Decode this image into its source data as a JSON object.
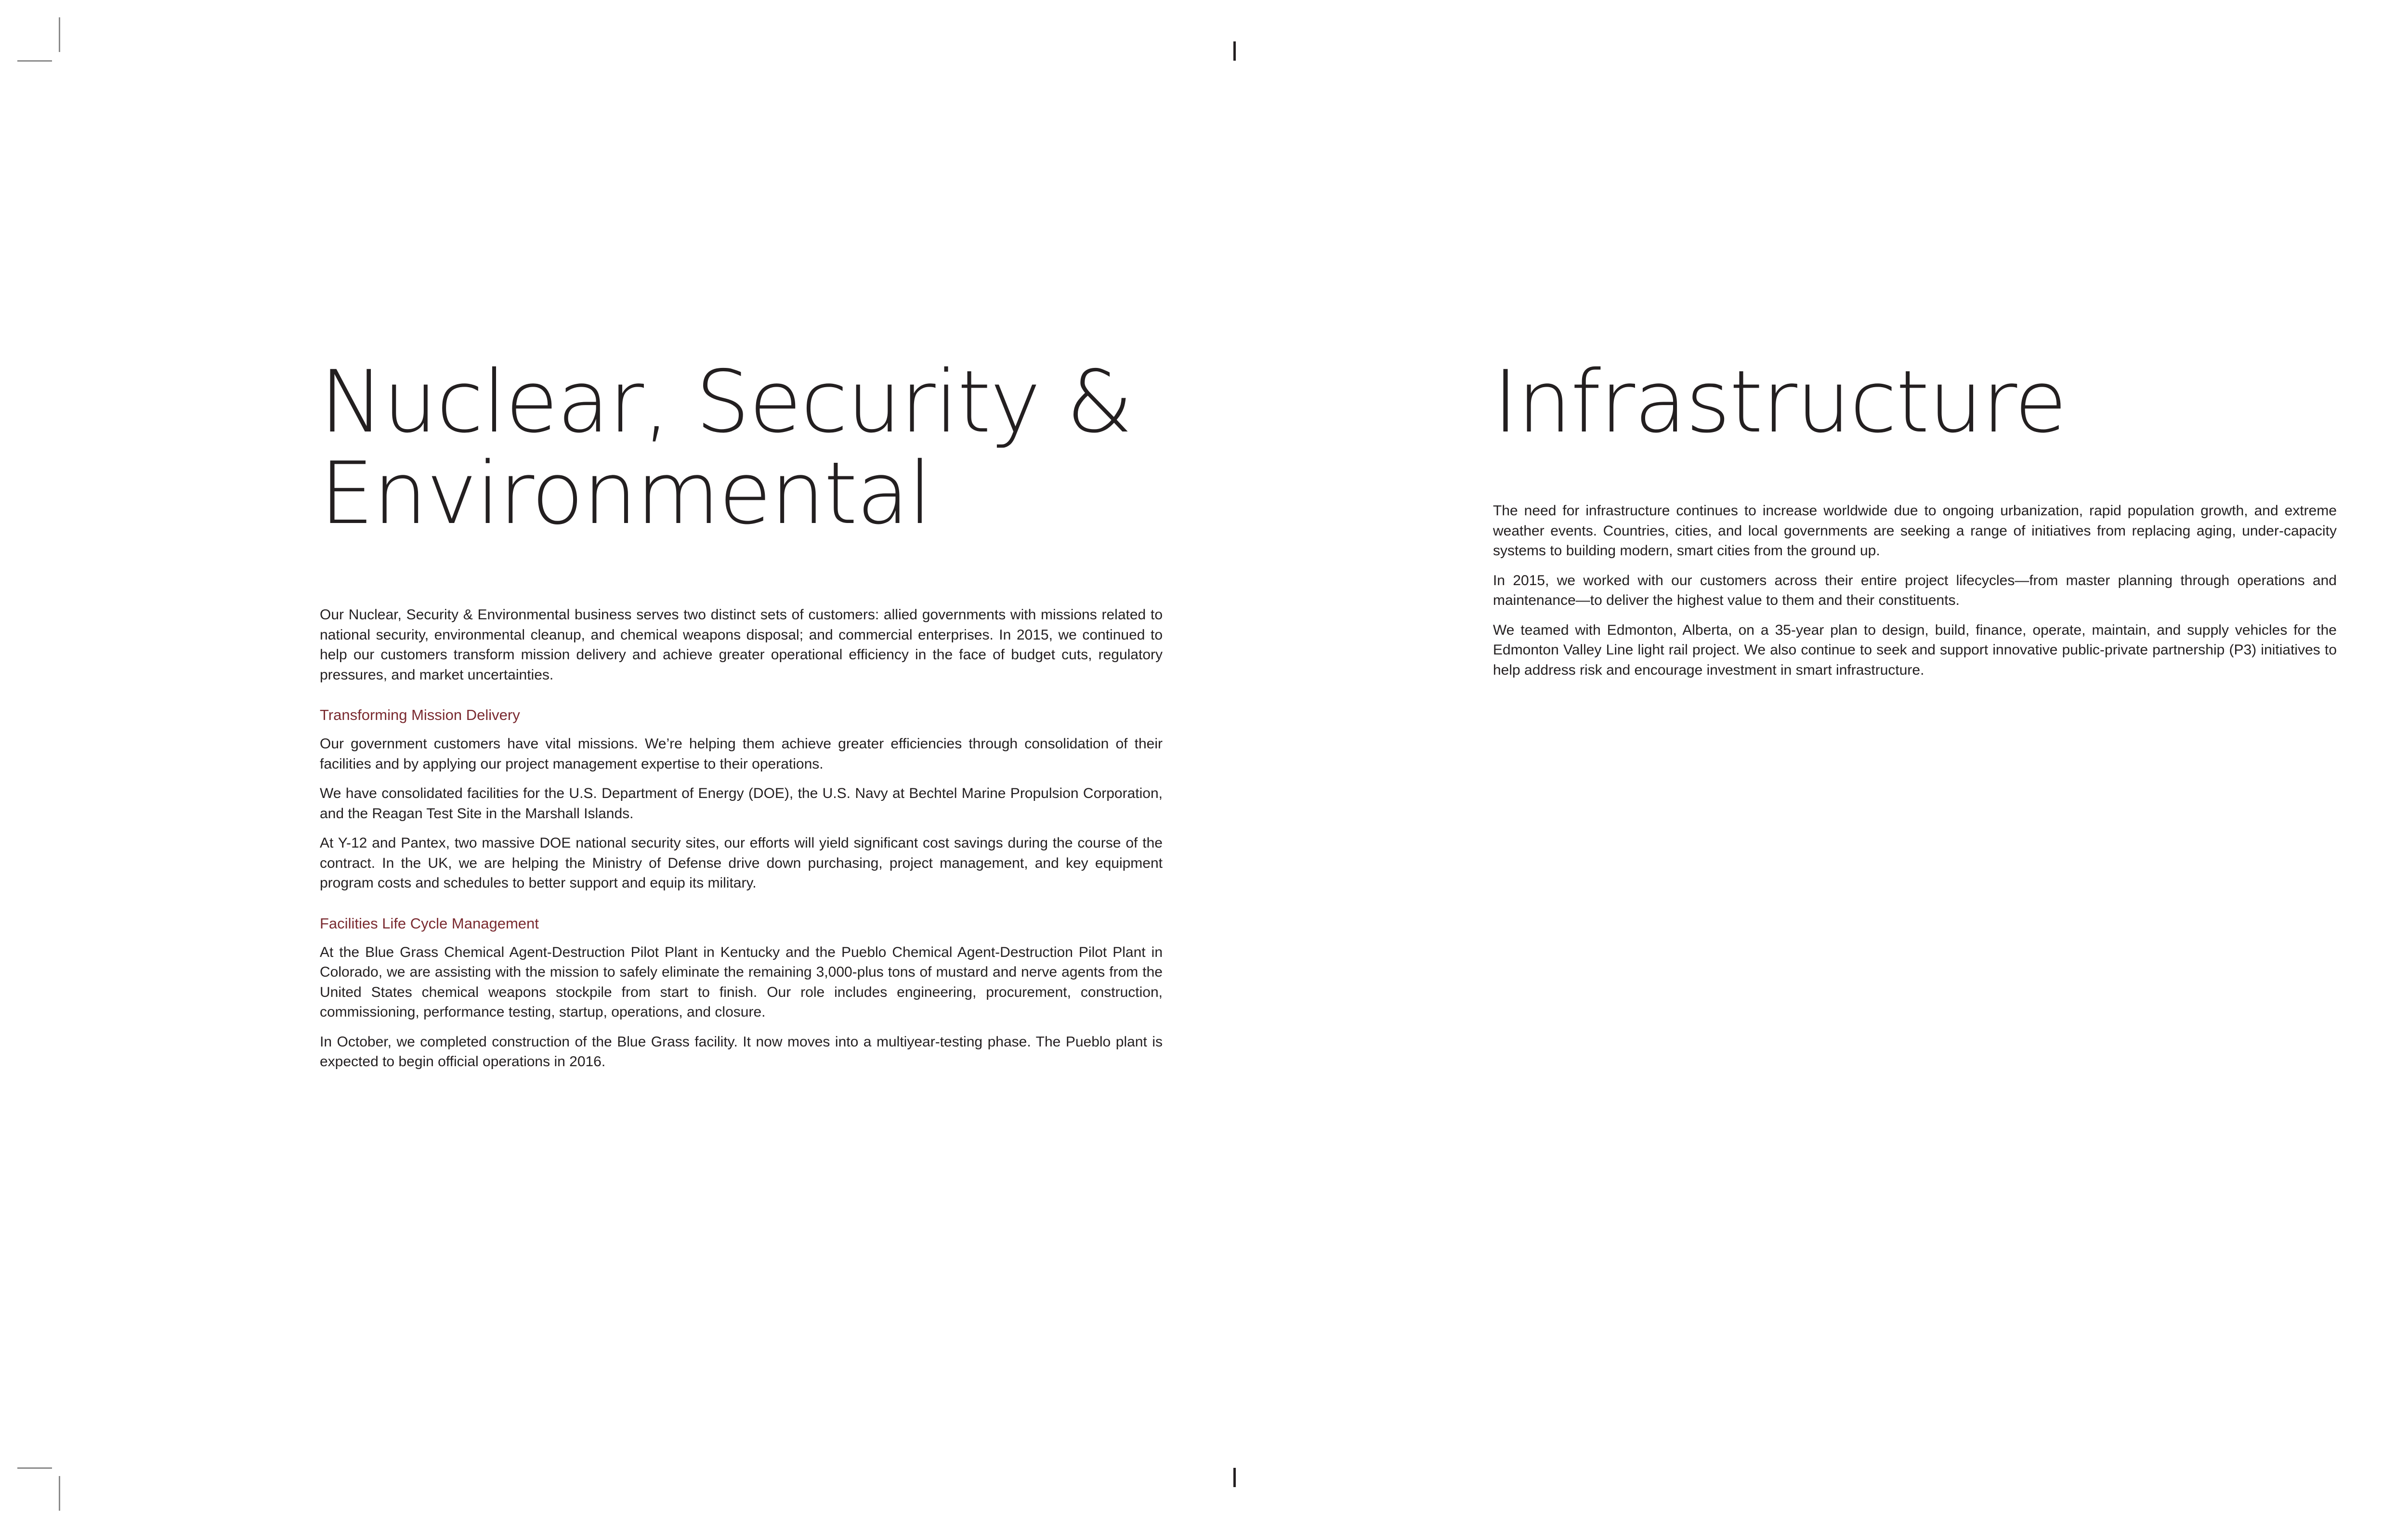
{
  "left": {
    "heading": "Nuclear, Security & Environmental",
    "intro": "Our Nuclear, Security & Environmental business serves two distinct sets of customers: allied governments with missions related to national security, environmental cleanup, and chemical weapons disposal; and commercial enterprises. In 2015, we continued to help our customers transform mission delivery and achieve greater operational efficiency in the face of budget cuts, regulatory pressures, and market uncertainties.",
    "sections": [
      {
        "subheading": "Transforming Mission Delivery",
        "paragraphs": [
          "Our government customers have vital missions. We’re helping them achieve greater efficiencies through consolidation of their facilities and by applying our project management expertise to their operations.",
          "We have consolidated facilities for the U.S. Department of Energy (DOE), the U.S. Navy at Bechtel Marine Propulsion Corporation, and the Reagan Test Site in the Marshall Islands.",
          "At Y-12 and Pantex, two massive DOE national security sites, our efforts will yield significant cost savings during the course of the contract. In the UK, we are helping the Ministry of Defense drive down purchasing, project management, and key equipment program costs and schedules to better support and equip its military."
        ]
      },
      {
        "subheading": "Facilities Life Cycle Management",
        "paragraphs": [
          "At the Blue Grass Chemical Agent-Destruction Pilot Plant in Kentucky and the Pueblo Chemical Agent-Destruction Pilot Plant in Colorado, we are assisting with the mission to safely eliminate the remaining 3,000-plus tons of mustard and nerve agents from the United States chemical weapons stockpile from start to finish. Our role includes engineering, procurement, construction, commissioning, performance testing, startup, operations, and closure.",
          "In October, we completed construction of the Blue Grass facility. It now moves into a multiyear-testing phase. The Pueblo plant is expected to begin official operations in 2016."
        ]
      }
    ]
  },
  "right": {
    "heading": "Infrastructure",
    "paragraphs": [
      "The need for infrastructure continues to increase worldwide due to ongoing urbanization, rapid population growth, and extreme weather events. Countries, cities, and local governments are seeking a range of initiatives from replacing aging, under-capacity systems to building modern, smart cities from the ground up.",
      "In 2015, we worked with our customers across their entire project lifecycles—from master planning through operations and maintenance—to deliver the highest value to them and their constituents.",
      "We teamed with Edmonton, Alberta, on a 35-year plan to design, build, finance, operate, maintain, and supply vehicles for the Edmonton Valley Line light rail project. We also continue to seek and support innovative public-private partnership (P3) initiatives to help address risk and encourage investment in smart infrastructure."
    ]
  }
}
